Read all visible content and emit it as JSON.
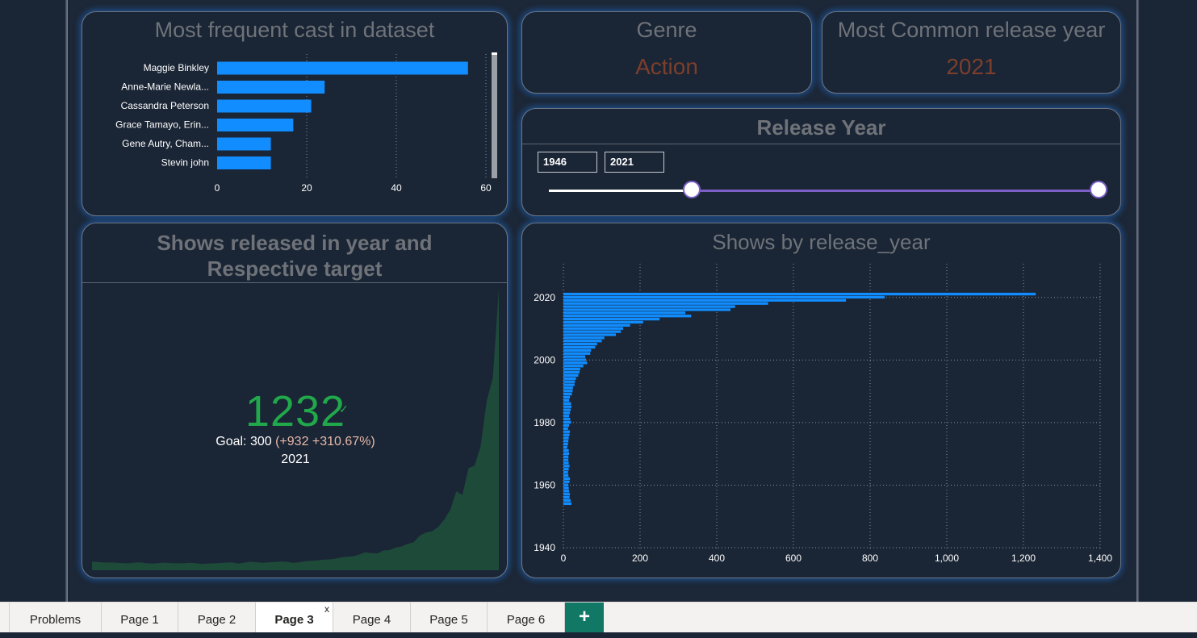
{
  "cast_card": {
    "title": "Most frequent cast in dataset",
    "chart_data": {
      "type": "bar",
      "orientation": "horizontal",
      "categories": [
        "Maggie Binkley",
        "Anne-Marie Newla...",
        "Cassandra Peterson",
        "Grace Tamayo, Erin...",
        "Gene Autry, Cham...",
        "Stevin john"
      ],
      "values": [
        56,
        24,
        21,
        17,
        12,
        12
      ],
      "xlim": [
        0,
        60
      ],
      "xticks": [
        "0",
        "20",
        "40",
        "60"
      ],
      "grid": true,
      "color": "#118dff"
    }
  },
  "genre_card": {
    "title": "Genre",
    "value": "Action"
  },
  "year_common_card": {
    "title": "Most Common release year",
    "value": "2021"
  },
  "slider_card": {
    "title": "Release Year",
    "start": "1946",
    "end": "2021"
  },
  "goal_card": {
    "title_line1": "Shows released in year and",
    "title_line2": "Respective target",
    "value": "1232",
    "check": "✓",
    "goal_text": "Goal: 300",
    "delta_text": "(+932 +310.67%)",
    "year": "2021",
    "area_color": "#1e4a3a"
  },
  "year_card": {
    "title": "Shows by release_year",
    "chart_data": {
      "type": "bar",
      "orientation": "horizontal",
      "y_years_from": 1946,
      "y_years_to": 2021,
      "values": [
        21,
        19,
        16,
        17,
        15,
        14,
        13,
        16,
        17,
        13,
        12,
        14,
        16,
        14,
        13,
        13,
        15,
        14,
        10,
        12,
        13,
        14,
        16,
        17,
        12,
        15,
        20,
        18,
        15,
        17,
        19,
        21,
        20,
        15,
        17,
        22,
        24,
        25,
        29,
        30,
        33,
        39,
        42,
        44,
        52,
        62,
        59,
        57,
        70,
        72,
        83,
        88,
        100,
        107,
        137,
        150,
        156,
        174,
        208,
        251,
        333,
        318,
        436,
        448,
        534,
        737,
        838,
        1232
      ],
      "yticks": [
        "1940",
        "1960",
        "1980",
        "2000",
        "2020"
      ],
      "ylim": [
        1940,
        2022
      ],
      "xlim": [
        0,
        1400
      ],
      "xticks": [
        "0",
        "200",
        "400",
        "600",
        "800",
        "1,000",
        "1,200",
        "1,400"
      ],
      "grid": true,
      "color": "#118dff"
    }
  },
  "tabs": {
    "items": [
      {
        "label": "Problems"
      },
      {
        "label": "Page 1"
      },
      {
        "label": "Page 2"
      },
      {
        "label": "Page 3",
        "active": true
      },
      {
        "label": "Page 4"
      },
      {
        "label": "Page 5"
      },
      {
        "label": "Page 6"
      }
    ],
    "close_glyph": "x",
    "add_glyph": "+"
  }
}
